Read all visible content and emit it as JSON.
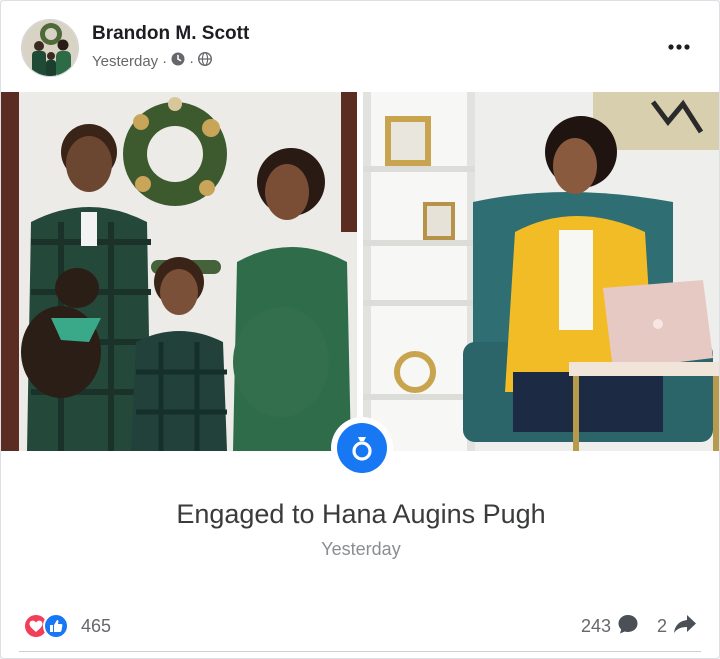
{
  "post": {
    "author": "Brandon M. Scott",
    "time": "Yesterday",
    "separator": "·",
    "icons": [
      "clock-icon",
      "globe-icon",
      "more-options-icon"
    ]
  },
  "photos": [
    {
      "name": "family-holiday-photo"
    },
    {
      "name": "woman-with-laptop-photo"
    }
  ],
  "life_event": {
    "icon": "ring-icon",
    "title": "Engaged to Hana Augins Pugh",
    "date": "Yesterday"
  },
  "footer": {
    "reaction_count": "465",
    "comment_count": "243",
    "share_count": "2",
    "reaction_icons": [
      "love-reaction-icon",
      "like-reaction-icon"
    ]
  },
  "colors": {
    "brand_blue": "#1877f2",
    "love_red": "#f33e58",
    "secondary_text": "#65676b"
  }
}
